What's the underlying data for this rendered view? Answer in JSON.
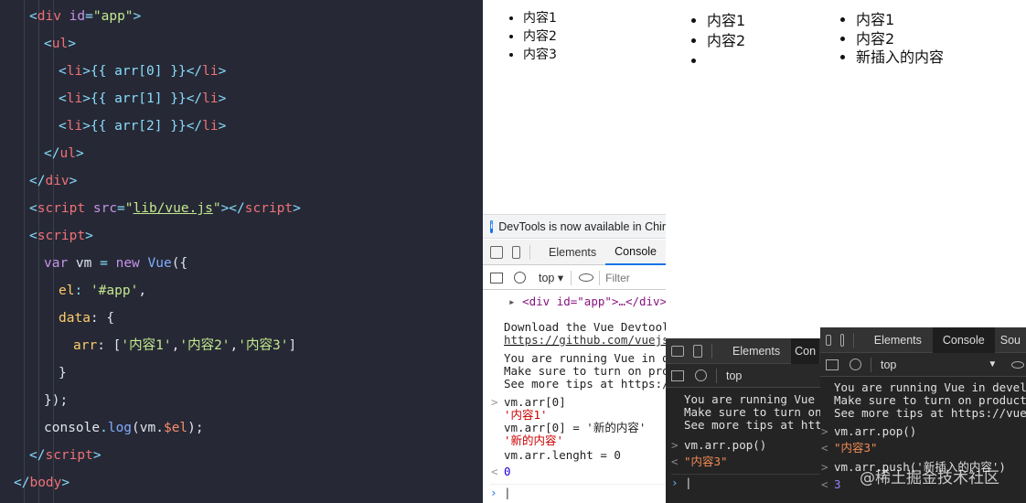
{
  "editor": {
    "lines": [
      [
        {
          "t": "<",
          "c": "t-punc"
        },
        {
          "t": "div",
          "c": "t-tag"
        },
        {
          "t": " id",
          "c": "t-attr"
        },
        {
          "t": "=",
          "c": "t-punc"
        },
        {
          "t": "\"app\"",
          "c": "t-str"
        },
        {
          "t": ">",
          "c": "t-punc"
        }
      ],
      [
        {
          "t": "<",
          "c": "t-punc"
        },
        {
          "t": "ul",
          "c": "t-tag"
        },
        {
          "t": ">",
          "c": "t-punc"
        }
      ],
      [
        {
          "t": "<",
          "c": "t-punc"
        },
        {
          "t": "li",
          "c": "t-tag"
        },
        {
          "t": ">{{ arr[0] }}</",
          "c": "t-punc"
        },
        {
          "t": "li",
          "c": "t-tag"
        },
        {
          "t": ">",
          "c": "t-punc"
        }
      ],
      [
        {
          "t": "<",
          "c": "t-punc"
        },
        {
          "t": "li",
          "c": "t-tag"
        },
        {
          "t": ">{{ arr[1] }}</",
          "c": "t-punc"
        },
        {
          "t": "li",
          "c": "t-tag"
        },
        {
          "t": ">",
          "c": "t-punc"
        }
      ],
      [
        {
          "t": "<",
          "c": "t-punc"
        },
        {
          "t": "li",
          "c": "t-tag"
        },
        {
          "t": ">{{ arr[2] }}</",
          "c": "t-punc"
        },
        {
          "t": "li",
          "c": "t-tag"
        },
        {
          "t": ">",
          "c": "t-punc"
        }
      ],
      [
        {
          "t": "</",
          "c": "t-punc"
        },
        {
          "t": "ul",
          "c": "t-tag"
        },
        {
          "t": ">",
          "c": "t-punc"
        }
      ],
      [
        {
          "t": "</",
          "c": "t-punc"
        },
        {
          "t": "div",
          "c": "t-tag"
        },
        {
          "t": ">",
          "c": "t-punc"
        }
      ],
      [
        {
          "t": "<",
          "c": "t-punc"
        },
        {
          "t": "script",
          "c": "t-tag"
        },
        {
          "t": " src",
          "c": "t-attr"
        },
        {
          "t": "=",
          "c": "t-punc"
        },
        {
          "t": "\"",
          "c": "t-str"
        },
        {
          "t": "lib/vue.js",
          "c": "t-str ul"
        },
        {
          "t": "\"",
          "c": "t-str"
        },
        {
          "t": "></",
          "c": "t-punc"
        },
        {
          "t": "script",
          "c": "t-tag"
        },
        {
          "t": ">",
          "c": "t-punc"
        }
      ],
      [
        {
          "t": "<",
          "c": "t-punc"
        },
        {
          "t": "script",
          "c": "t-tag"
        },
        {
          "t": ">",
          "c": "t-punc"
        }
      ],
      [
        {
          "t": "var",
          "c": "t-key"
        },
        {
          "t": " vm ",
          "c": "t-var"
        },
        {
          "t": "=",
          "c": "t-punc"
        },
        {
          "t": " new ",
          "c": "t-key"
        },
        {
          "t": "Vue",
          "c": "t-fn"
        },
        {
          "t": "({",
          "c": "t-var"
        }
      ],
      [
        {
          "t": "el",
          "c": "t-prop"
        },
        {
          "t": ": ",
          "c": "t-punc"
        },
        {
          "t": "'#app'",
          "c": "t-str"
        },
        {
          "t": ",",
          "c": "t-var"
        }
      ],
      [
        {
          "t": "data",
          "c": "t-prop"
        },
        {
          "t": ": {",
          "c": "t-var"
        }
      ],
      [
        {
          "t": "arr",
          "c": "t-prop"
        },
        {
          "t": ": [",
          "c": "t-var"
        },
        {
          "t": "'内容1'",
          "c": "t-str"
        },
        {
          "t": ",",
          "c": "t-var"
        },
        {
          "t": "'内容2'",
          "c": "t-str"
        },
        {
          "t": ",",
          "c": "t-var"
        },
        {
          "t": "'内容3'",
          "c": "t-str"
        },
        {
          "t": "]",
          "c": "t-var"
        }
      ],
      [
        {
          "t": "}",
          "c": "t-var"
        }
      ],
      [
        {
          "t": "});",
          "c": "t-var"
        }
      ],
      [
        {
          "t": "console",
          "c": "t-var"
        },
        {
          "t": ".",
          "c": "t-punc"
        },
        {
          "t": "log",
          "c": "t-fn"
        },
        {
          "t": "(vm.",
          "c": "t-var"
        },
        {
          "t": "$el",
          "c": "t-obj"
        },
        {
          "t": ");",
          "c": "t-var"
        }
      ],
      [
        {
          "t": "</",
          "c": "t-punc"
        },
        {
          "t": "script",
          "c": "t-tag"
        },
        {
          "t": ">",
          "c": "t-punc"
        }
      ],
      [
        {
          "t": "</",
          "c": "t-punc"
        },
        {
          "t": "body",
          "c": "t-tag"
        },
        {
          "t": ">",
          "c": "t-punc"
        }
      ]
    ]
  },
  "render": {
    "list1": [
      "内容1",
      "内容2",
      "内容3"
    ],
    "list2": [
      "内容1",
      "内容2",
      ""
    ],
    "list3": [
      "内容1",
      "内容2",
      "新插入的内容"
    ]
  },
  "devtools1": {
    "banner": "DevTools is now available in Chir",
    "tabs": [
      "Elements",
      "Console"
    ],
    "context": "top",
    "filter_placeholder": "Filter",
    "element_node": "<div id=\"app\">…</div>",
    "messages": [
      {
        "text": "Download the Vue Devtools",
        "kind": "log"
      },
      {
        "text": "https://github.com/vuejs/",
        "kind": "link"
      },
      {
        "text": "You are running Vue in de",
        "kind": "log"
      },
      {
        "text": "Make sure to turn on prod",
        "kind": "log"
      },
      {
        "text": "See more tips at https://",
        "kind": "log"
      }
    ],
    "history": [
      {
        "prompt": ">",
        "text": "vm.arr[0]",
        "kind": "input"
      },
      {
        "prompt": "",
        "text": "'内容1'",
        "kind": "str"
      },
      {
        "prompt": "",
        "text": "vm.arr[0] = '新的内容'",
        "kind": "input"
      },
      {
        "prompt": "",
        "text": "'新的内容'",
        "kind": "str"
      },
      {
        "prompt": "",
        "text": "vm.arr.lenght = 0",
        "kind": "input"
      },
      {
        "prompt": "<",
        "text": "0",
        "kind": "num"
      }
    ]
  },
  "devtools2": {
    "tabs": [
      "Elements",
      "Con"
    ],
    "context": "top",
    "messages": [
      "You are running Vue in",
      "Make sure to turn on p",
      "See more tips at https"
    ],
    "history": [
      {
        "prompt": ">",
        "text": "vm.arr.pop()",
        "kind": "input"
      },
      {
        "prompt": "<",
        "text": "\"内容3\"",
        "kind": "str"
      }
    ]
  },
  "devtools3": {
    "tabs": [
      "Elements",
      "Console",
      "Sou"
    ],
    "context": "top",
    "messages": [
      "You are running Vue in developme",
      "Make sure to turn on production m",
      "See more tips at https://vuejs.or"
    ],
    "history": [
      {
        "prompt": ">",
        "text": "vm.arr.pop()",
        "kind": "input"
      },
      {
        "prompt": "<",
        "text": "\"内容3\"",
        "kind": "str"
      },
      {
        "prompt": ">",
        "text": "vm.arr.push('新插入的内容')",
        "kind": "input"
      },
      {
        "prompt": "<",
        "text": "3",
        "kind": "num"
      }
    ]
  },
  "watermark": "@稀土掘金技术社区"
}
